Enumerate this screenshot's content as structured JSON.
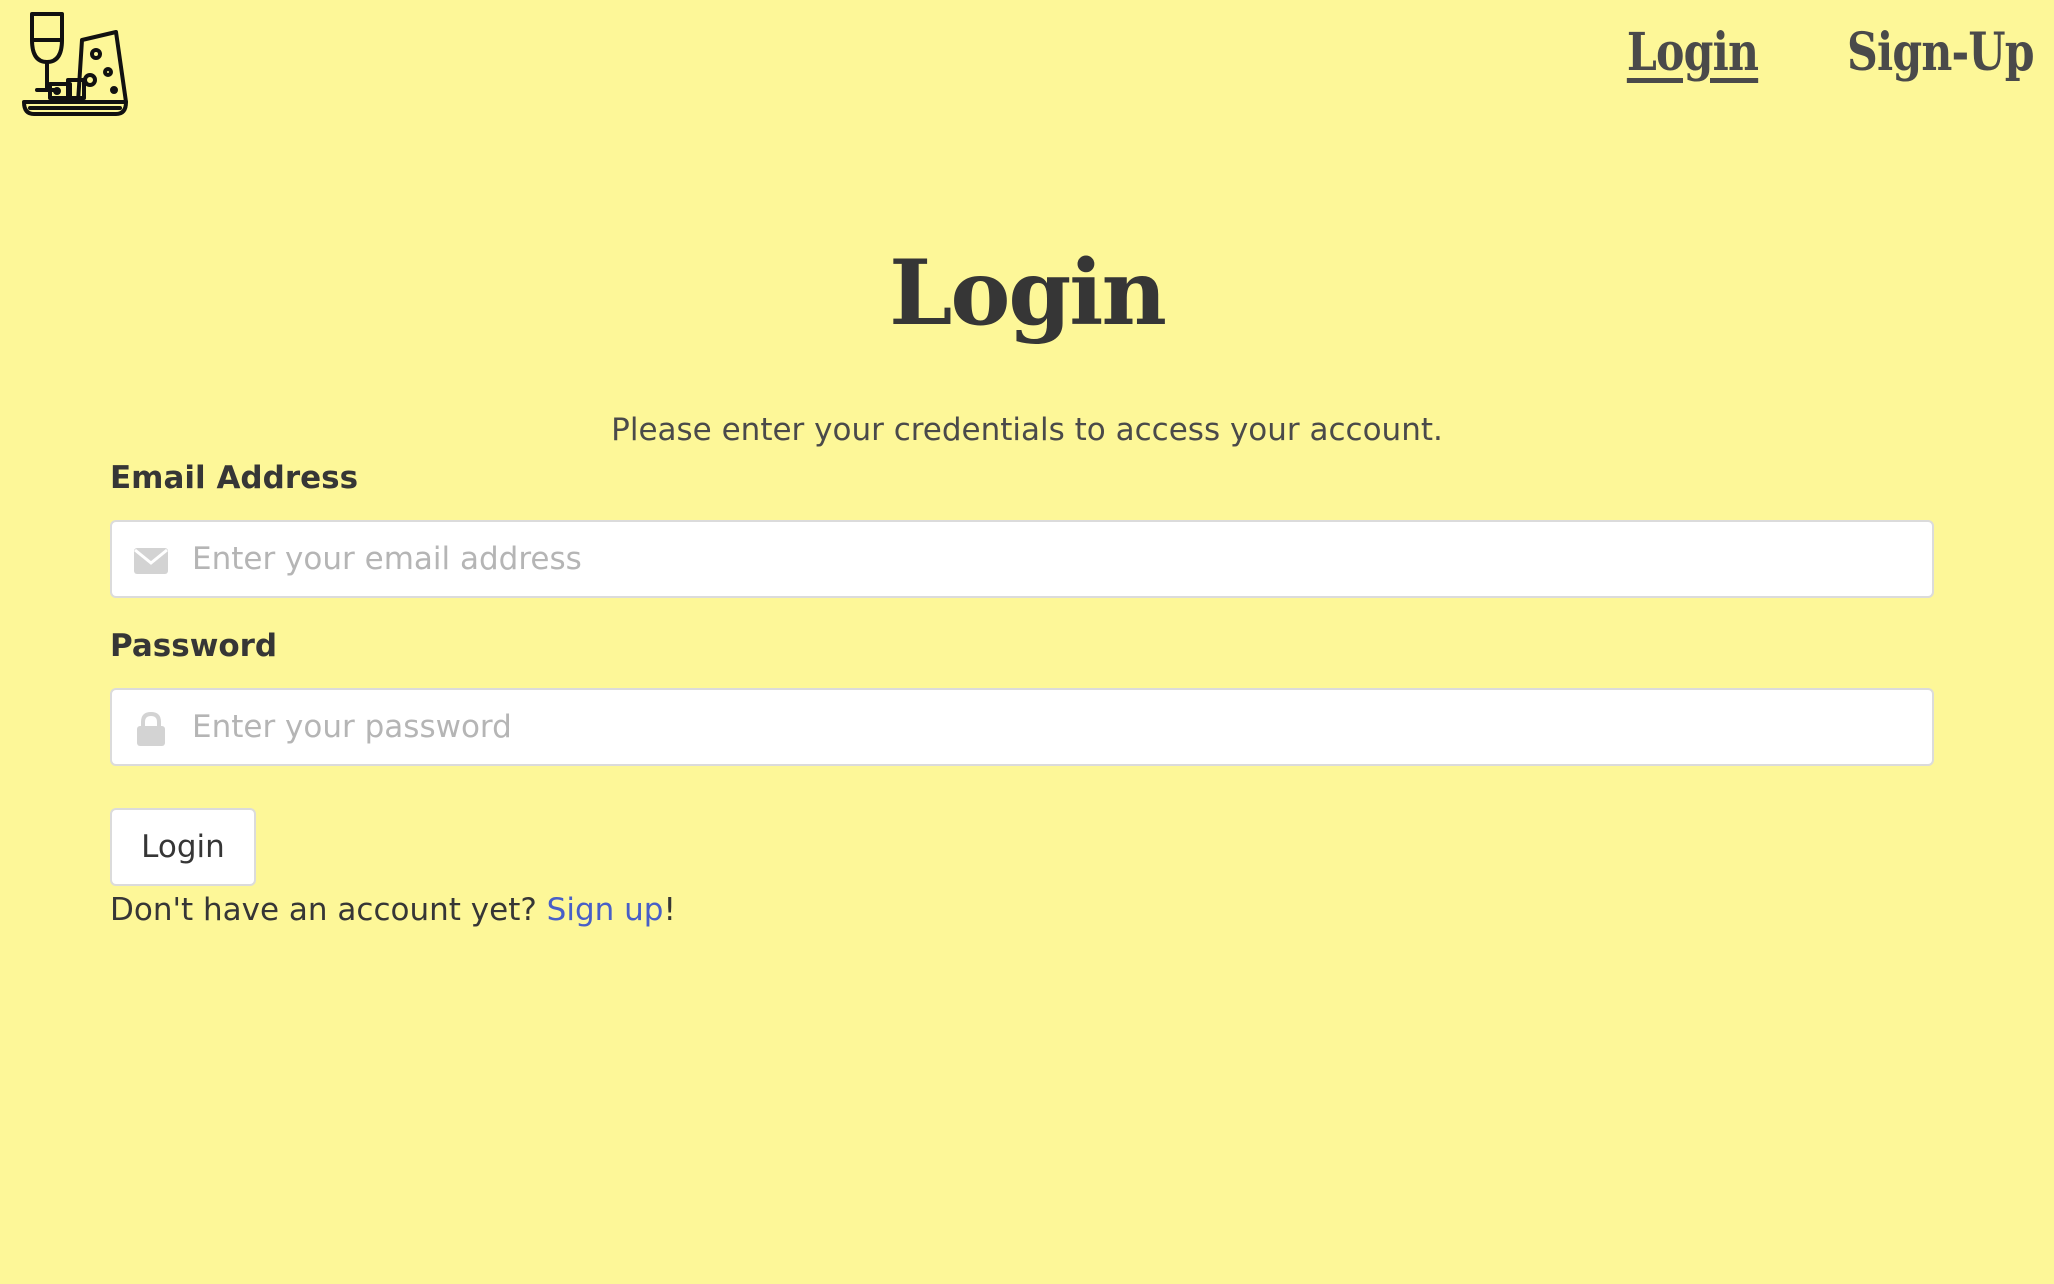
{
  "nav": {
    "logo_icon": "wine-and-cheese-logo",
    "links": [
      {
        "label": "Login",
        "active": true
      },
      {
        "label": "Sign-Up",
        "active": false
      }
    ]
  },
  "main": {
    "title": "Login",
    "subtitle": "Please enter your credentials to access your account.",
    "email": {
      "label": "Email Address",
      "placeholder": "Enter your email address",
      "value": "",
      "icon": "envelope-icon"
    },
    "password": {
      "label": "Password",
      "placeholder": "Enter your password",
      "value": "",
      "icon": "lock-icon"
    },
    "submit_label": "Login",
    "signup_prompt": "Don't have an account yet? ",
    "signup_link": "Sign up",
    "signup_suffix": "!"
  },
  "colors": {
    "background": "#fdf798",
    "text": "#363636",
    "link": "#485fc7",
    "input_border": "#dbdbdb",
    "placeholder": "#b5b5b5"
  }
}
